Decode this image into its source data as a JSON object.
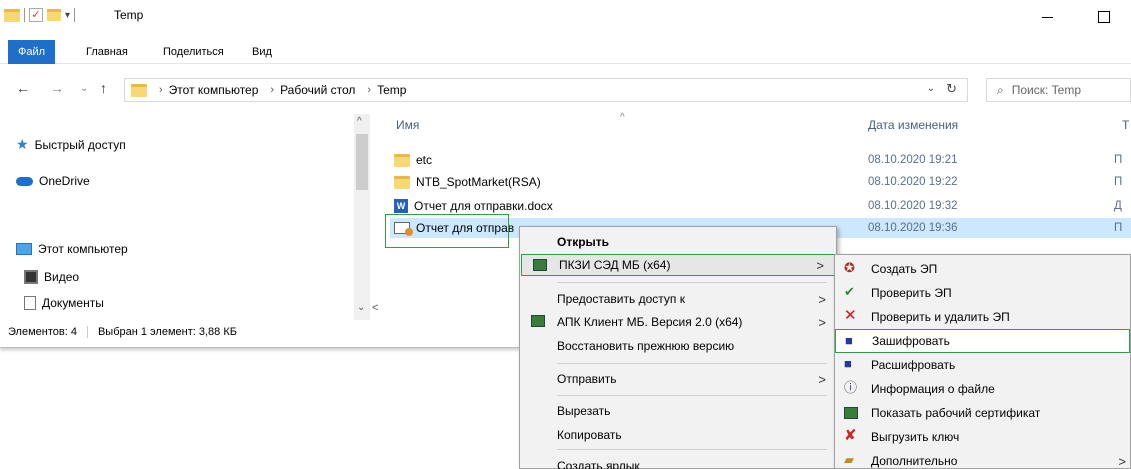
{
  "window": {
    "title": "Temp"
  },
  "ribbon": {
    "tabs": [
      "Файл",
      "Главная",
      "Поделиться",
      "Вид"
    ]
  },
  "address": {
    "crumbs": [
      "Этот компьютер",
      "Рабочий стол",
      "Temp"
    ],
    "search_placeholder": "Поиск: Temp"
  },
  "navpane": {
    "items": [
      "Быстрый доступ",
      "OneDrive",
      "Этот компьютер",
      "Видео",
      "Документы"
    ]
  },
  "statusbar": {
    "count": "Элементов: 4",
    "selection": "Выбран 1 элемент: 3,88 КБ"
  },
  "columns": {
    "name": "Имя",
    "date": "Дата изменения",
    "type": "Т"
  },
  "files": [
    {
      "name": "etc",
      "date": "08.10.2020 19:21",
      "type": "П"
    },
    {
      "name": "NTB_SpotMarket(RSA)",
      "date": "08.10.2020 19:22",
      "type": "П"
    },
    {
      "name": "Отчет для отправки.docx",
      "date": "08.10.2020 19:32",
      "type": "Д"
    },
    {
      "name": "Отчет для отправ",
      "date": "08.10.2020 19:36",
      "type": "П"
    }
  ],
  "context_menu": {
    "items": [
      "Открыть",
      "ПКЗИ СЭД МБ (x64)",
      "Предоставить доступ к",
      "АПК Клиент МБ. Версия 2.0 (x64)",
      "Восстановить прежнюю версию",
      "Отправить",
      "Вырезать",
      "Копировать",
      "Создать ярлык"
    ]
  },
  "submenu": {
    "items": [
      "Создать ЭП",
      "Проверить ЭП",
      "Проверить и удалить ЭП",
      "Зашифровать",
      "Расшифровать",
      "Информация о файле",
      "Показать рабочий сертификат",
      "Выгрузить ключ",
      "Дополнительно"
    ]
  }
}
